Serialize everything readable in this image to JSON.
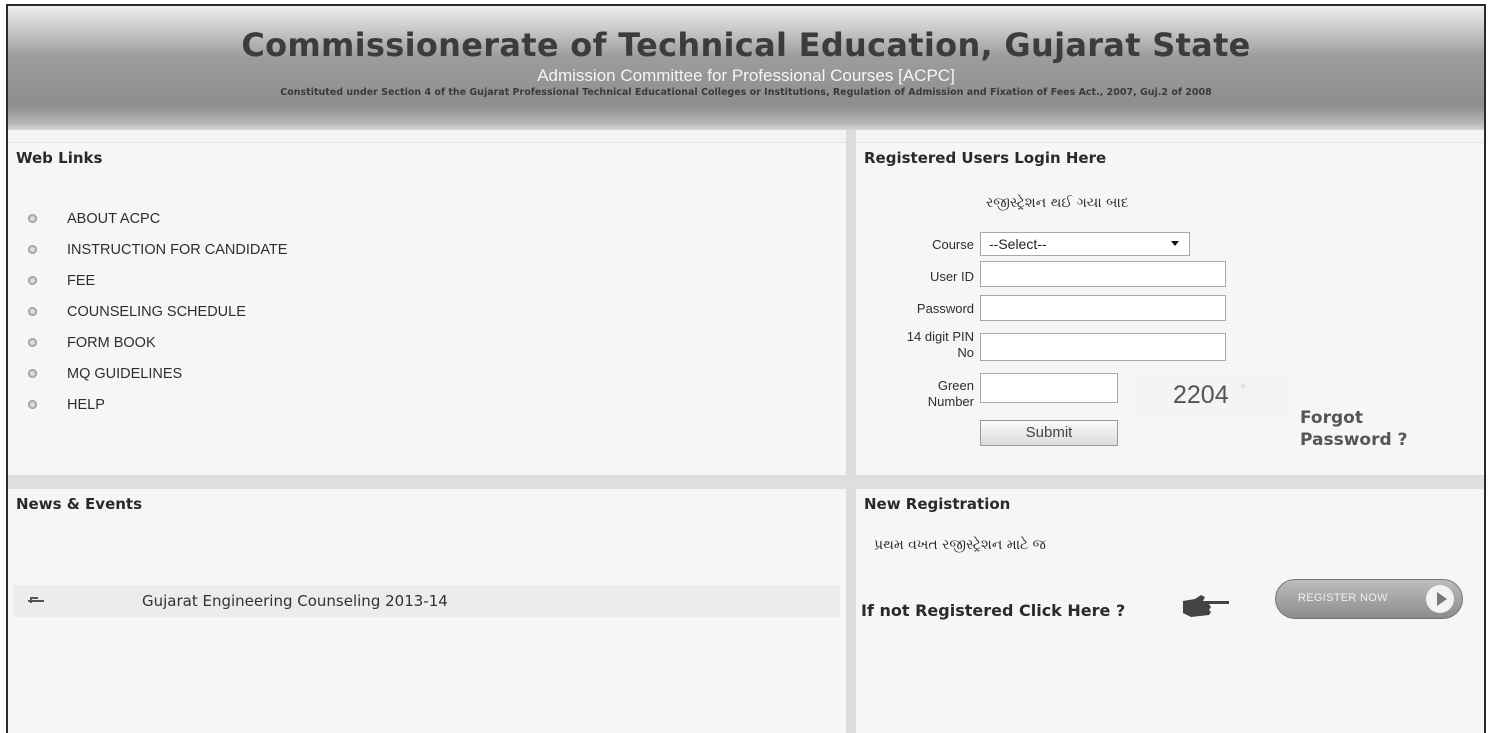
{
  "header": {
    "title": "Commissionerate of Technical Education, Gujarat State",
    "subtitle": "Admission Committee for Professional Courses [ACPC]",
    "constituted": "Constituted under Section 4 of the Gujarat Professional Technical Educational Colleges or Institutions, Regulation of Admission and Fixation of Fees Act., 2007, Guj.2 of 2008"
  },
  "web_links": {
    "title": "Web Links",
    "items": [
      {
        "label": "ABOUT ACPC"
      },
      {
        "label": "INSTRUCTION FOR CANDIDATE"
      },
      {
        "label": "FEE"
      },
      {
        "label": "COUNSELING SCHEDULE"
      },
      {
        "label": "FORM BOOK"
      },
      {
        "label": "MQ GUIDELINES"
      },
      {
        "label": "HELP"
      }
    ]
  },
  "login": {
    "title": "Registered Users Login Here",
    "gujarati_note": "રજીસ્ટ્રેશન થઈ ગયા બાદ",
    "course_label": "Course",
    "course_value": "--Select--",
    "userid_label": "User ID",
    "password_label": "Password",
    "pin_label": "14 digit PIN No",
    "green_label": "Green Number",
    "captcha": "2204",
    "submit": "Submit",
    "forgot": "Forgot Password ?"
  },
  "news": {
    "title": "News & Events",
    "items": [
      {
        "text": "Gujarat Engineering Counseling 2013-14"
      }
    ]
  },
  "new_registration": {
    "title": "New Registration",
    "gujarati_note": "પ્રથમ વખત રજીસ્ટ્રેશન માટે જ",
    "prompt": "If not Registered Click Here ?",
    "button": "REGISTER NOW"
  }
}
